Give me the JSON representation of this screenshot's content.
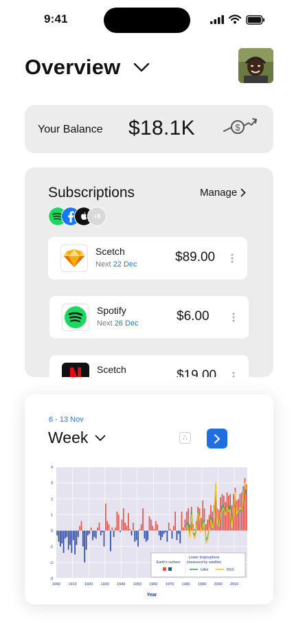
{
  "status_bar": {
    "time": "9:41"
  },
  "header": {
    "title": "Overview"
  },
  "balance": {
    "label": "Your Balance",
    "value": "$18.1K"
  },
  "subscriptions": {
    "title": "Subscriptions",
    "manage_label": "Manage",
    "more_count": "+9",
    "items": [
      {
        "name": "Scetch",
        "next_label": "Next",
        "next_date": "22 Dec",
        "price": "$89.00",
        "icon": "sketch-icon"
      },
      {
        "name": "Spotify",
        "next_label": "Next",
        "next_date": "26 Dec",
        "price": "$6.00",
        "icon": "spotify-icon"
      },
      {
        "name": "Scetch",
        "next_label": "Next",
        "next_date": "",
        "price": "$19.00",
        "icon": "netflix-icon"
      }
    ]
  },
  "week_panel": {
    "range": "6 - 13 Nov",
    "title": "Week"
  },
  "colors": {
    "accent": "#1f6fe0",
    "date_blue": "#2b73c9",
    "card_bg": "#ececec",
    "surface": "#e5534b",
    "satellite_uah": "#2e9e68",
    "satellite_rss": "#f3c21b"
  },
  "chart_data": {
    "type": "bar",
    "xlabel": "Year",
    "ylabel": "",
    "x_ticks": [
      "1900",
      "1910",
      "1920",
      "1930",
      "1940",
      "1950",
      "1960",
      "1970",
      "1980",
      "1990",
      "2000",
      "2010",
      "2"
    ],
    "y_ticks": [
      "4",
      "3",
      "2",
      "1",
      "0",
      "-1",
      "-2",
      "-3"
    ],
    "xlim": [
      1900,
      2018
    ],
    "ylim": [
      -3,
      4
    ],
    "grid": true,
    "legend_position": "bottom-right",
    "legend": {
      "surface_title": "Earth's surface",
      "satellite_title_line1": "Lower troposphere",
      "satellite_title_line2": "(measured by satellite)",
      "uah_label": "UAH",
      "rss_label": "RSS"
    },
    "surface_series": {
      "name": "Earth's surface",
      "x": [
        1900,
        1901,
        1902,
        1903,
        1904,
        1905,
        1906,
        1907,
        1908,
        1909,
        1910,
        1911,
        1912,
        1913,
        1914,
        1915,
        1916,
        1917,
        1918,
        1919,
        1920,
        1921,
        1922,
        1923,
        1924,
        1925,
        1926,
        1927,
        1928,
        1929,
        1930,
        1931,
        1932,
        1933,
        1934,
        1935,
        1936,
        1937,
        1938,
        1939,
        1940,
        1941,
        1942,
        1943,
        1944,
        1945,
        1946,
        1947,
        1948,
        1949,
        1950,
        1951,
        1952,
        1953,
        1954,
        1955,
        1956,
        1957,
        1958,
        1959,
        1960,
        1961,
        1962,
        1963,
        1964,
        1965,
        1966,
        1967,
        1968,
        1969,
        1970,
        1971,
        1972,
        1973,
        1974,
        1975,
        1976,
        1977,
        1978,
        1979,
        1980,
        1981,
        1982,
        1983,
        1984,
        1985,
        1986,
        1987,
        1988,
        1989,
        1990,
        1991,
        1992,
        1993,
        1994,
        1995,
        1996,
        1997,
        1998,
        1999,
        2000,
        2001,
        2002,
        2003,
        2004,
        2005,
        2006,
        2007,
        2008,
        2009,
        2010,
        2011,
        2012,
        2013,
        2014,
        2015,
        2016,
        2017
      ],
      "values": [
        -0.3,
        -0.7,
        -1.0,
        -0.8,
        -1.4,
        -0.5,
        -0.4,
        -1.2,
        -0.9,
        -1.4,
        -0.6,
        -1.5,
        -0.9,
        -0.4,
        0.3,
        0.6,
        -1.0,
        -2.0,
        -1.2,
        -0.3,
        -0.2,
        0.2,
        -0.6,
        -0.4,
        -0.5,
        0.2,
        0.5,
        -0.3,
        -0.1,
        -1.0,
        1.7,
        0.6,
        0.4,
        -1.3,
        0.2,
        -0.4,
        0.2,
        1.2,
        1.0,
        -0.1,
        0.7,
        1.4,
        0.5,
        0.3,
        1.1,
        0.1,
        -0.3,
        0.5,
        -0.7,
        -0.6,
        -1.0,
        0.1,
        0.4,
        1.4,
        -0.5,
        -0.7,
        -0.6,
        0.9,
        0.7,
        0.3,
        0.1,
        0.6,
        0.4,
        -0.3,
        -0.6,
        -0.4,
        -0.2,
        -0.1,
        -0.7,
        0.5,
        0.1,
        -0.5,
        0.3,
        1.2,
        -0.6,
        -0.2,
        -0.8,
        1.2,
        0.2,
        0.7,
        1.2,
        1.4,
        0.4,
        1.5,
        0.4,
        0.1,
        0.6,
        1.5,
        1.4,
        0.8,
        1.9,
        1.4,
        0.4,
        0.7,
        1.0,
        1.6,
        1.2,
        1.6,
        2.6,
        1.4,
        1.3,
        2.1,
        2.3,
        2.2,
        1.8,
        2.4,
        2.2,
        2.3,
        1.6,
        2.3,
        2.7,
        1.9,
        2.0,
        2.3,
        2.4,
        2.8,
        3.3,
        2.9
      ]
    },
    "uah_series": {
      "name": "UAH",
      "x": [
        1979,
        1980,
        1981,
        1982,
        1983,
        1984,
        1985,
        1986,
        1987,
        1988,
        1989,
        1990,
        1991,
        1992,
        1993,
        1994,
        1995,
        1996,
        1997,
        1998,
        1999,
        2000,
        2001,
        2002,
        2003,
        2004,
        2005,
        2006,
        2007,
        2008,
        2009,
        2010,
        2011,
        2012,
        2013,
        2014,
        2015,
        2016,
        2017
      ],
      "values": [
        0.2,
        0.4,
        0.5,
        -0.2,
        1.3,
        -0.1,
        -0.3,
        0.1,
        1.2,
        0.8,
        0.0,
        0.6,
        0.6,
        -0.6,
        -0.4,
        0.1,
        0.9,
        0.3,
        0.9,
        2.8,
        0.3,
        0.5,
        1.1,
        1.6,
        1.5,
        1.2,
        1.6,
        1.3,
        1.6,
        0.3,
        1.3,
        2.2,
        0.9,
        1.1,
        1.4,
        1.2,
        1.7,
        2.7,
        2.2
      ]
    },
    "rss_series": {
      "name": "RSS",
      "x": [
        1979,
        1980,
        1981,
        1982,
        1983,
        1984,
        1985,
        1986,
        1987,
        1988,
        1989,
        1990,
        1991,
        1992,
        1993,
        1994,
        1995,
        1996,
        1997,
        1998,
        1999,
        2000,
        2001,
        2002,
        2003,
        2004,
        2005,
        2006,
        2007,
        2008,
        2009,
        2010,
        2011,
        2012,
        2013,
        2014,
        2015,
        2016,
        2017
      ],
      "values": [
        0.1,
        0.3,
        0.2,
        -0.4,
        1.0,
        -0.2,
        -0.5,
        0.0,
        1.1,
        0.9,
        -0.1,
        0.4,
        0.5,
        -0.8,
        -0.6,
        0.0,
        0.7,
        0.2,
        0.8,
        3.0,
        0.4,
        0.3,
        1.0,
        1.3,
        1.4,
        1.0,
        1.5,
        1.2,
        1.3,
        0.2,
        1.1,
        2.4,
        1.0,
        1.2,
        1.4,
        1.3,
        2.0,
        3.0,
        2.6
      ]
    }
  }
}
